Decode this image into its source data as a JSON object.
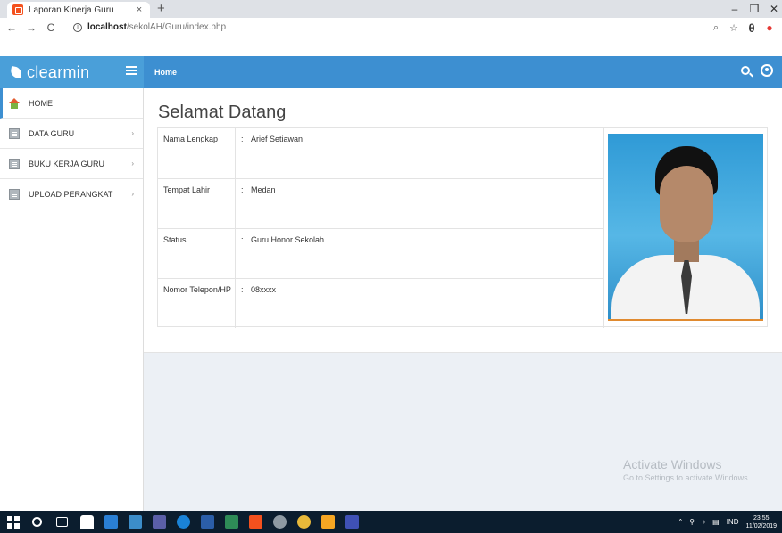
{
  "browser": {
    "tab_title": "Laporan Kinerja Guru",
    "tab_close": "×",
    "new_tab": "+",
    "minimize": "–",
    "restore": "❐",
    "close": "✕",
    "back": "←",
    "forward": "→",
    "reload": "C",
    "url_host": "localhost",
    "url_path": "/sekolAH/Guru/index.php",
    "zoom_icon": "🔍",
    "star_icon": "☆"
  },
  "app": {
    "brand": "clearmin",
    "header_title": "Home"
  },
  "sidebar": {
    "items": [
      {
        "label": "HOME",
        "icon": "home-icon",
        "active": true
      },
      {
        "label": "DATA GURU",
        "icon": "document-icon",
        "arrow": "›"
      },
      {
        "label": "BUKU KERJA GURU",
        "icon": "document-icon",
        "arrow": "›"
      },
      {
        "label": "UPLOAD PERANGKAT",
        "icon": "document-icon",
        "arrow": "›"
      }
    ]
  },
  "main": {
    "title": "Selamat Datang",
    "profile": [
      {
        "label": "Nama Lengkap",
        "sep": ":",
        "value": "Arief Setiawan"
      },
      {
        "label": "Tempat Lahir",
        "sep": ":",
        "value": "Medan"
      },
      {
        "label": "Status",
        "sep": ":",
        "value": "Guru Honor Sekolah"
      },
      {
        "label": "Nomor Telepon/HP",
        "sep": ":",
        "value": "08xxxx"
      }
    ]
  },
  "watermark": {
    "title": "Activate Windows",
    "subtitle": "Go to Settings to activate Windows."
  },
  "taskbar": {
    "tray_arrow": "^",
    "language": "IND",
    "time": "23:55",
    "date": "11/02/2019"
  },
  "colors": {
    "header_left": "#4a9fd9",
    "header_right": "#3d8fd1",
    "content_bg": "#ecf0f5",
    "taskbar": "#0b1d2e"
  }
}
